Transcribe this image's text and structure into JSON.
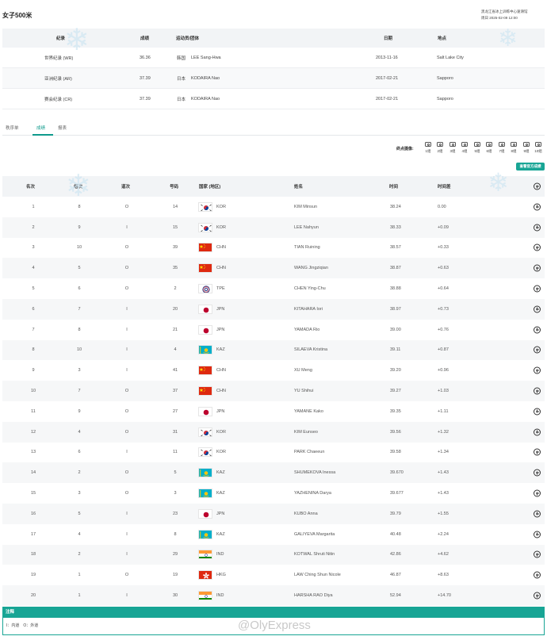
{
  "header": {
    "title": "女子500米",
    "venue_line1": "黑龙江省冰上训练中心速滑馆",
    "venue_line2": "周日 2025-02-09 12:00"
  },
  "records": {
    "headers": [
      "纪录",
      "成绩",
      "运动员/团体",
      "日期",
      "地点"
    ],
    "rows": [
      {
        "type": "世界纪录 (WR)",
        "time": "36.36",
        "country": "韩国",
        "athlete": "LEE Sang-Hwa",
        "date": "2013-11-16",
        "place": "Salt Lake City"
      },
      {
        "type": "亚洲纪录 (AR)",
        "time": "37.39",
        "country": "日本",
        "athlete": "KODAIRA Nao",
        "date": "2017-02-21",
        "place": "Sapporo"
      },
      {
        "type": "赛会纪录 (CR)",
        "time": "37.39",
        "country": "日本",
        "athlete": "KODAIRA Nao",
        "date": "2017-02-21",
        "place": "Sapporo"
      }
    ]
  },
  "tabs": [
    "秩序单",
    "成绩",
    "报表"
  ],
  "cameras": {
    "label": "终点摄像:",
    "groups": [
      "1组",
      "2组",
      "3组",
      "4组",
      "5组",
      "6组",
      "7组",
      "8组",
      "9组",
      "10组"
    ]
  },
  "official_button": "查看官方成绩",
  "results": {
    "headers": [
      "名次",
      "组次",
      "道次",
      "号码",
      "国家 (地区)",
      "姓名",
      "时间",
      "时间差"
    ],
    "rows": [
      {
        "rank": "1",
        "group": "8",
        "lane": "O",
        "bib": "14",
        "noc": "KOR",
        "name": "KIM Minsun",
        "time": "38.24",
        "diff": "0.00"
      },
      {
        "rank": "2",
        "group": "9",
        "lane": "I",
        "bib": "15",
        "noc": "KOR",
        "name": "LEE Nahyun",
        "time": "38.33",
        "diff": "+0.09"
      },
      {
        "rank": "3",
        "group": "10",
        "lane": "O",
        "bib": "39",
        "noc": "CHN",
        "name": "TIAN Ruining",
        "time": "38.57",
        "diff": "+0.33"
      },
      {
        "rank": "4",
        "group": "5",
        "lane": "O",
        "bib": "35",
        "noc": "CHN",
        "name": "WANG Jingziqian",
        "time": "38.87",
        "diff": "+0.63"
      },
      {
        "rank": "5",
        "group": "6",
        "lane": "O",
        "bib": "2",
        "noc": "TPE",
        "name": "CHEN Ying-Chu",
        "time": "38.88",
        "diff": "+0.64"
      },
      {
        "rank": "6",
        "group": "7",
        "lane": "I",
        "bib": "20",
        "noc": "JPN",
        "name": "KITAHARA Iori",
        "time": "38.97",
        "diff": "+0.73"
      },
      {
        "rank": "7",
        "group": "8",
        "lane": "I",
        "bib": "21",
        "noc": "JPN",
        "name": "YAMADA Rio",
        "time": "39.00",
        "diff": "+0.76"
      },
      {
        "rank": "8",
        "group": "10",
        "lane": "I",
        "bib": "4",
        "noc": "KAZ",
        "name": "SILAEVA Kristina",
        "time": "39.11",
        "diff": "+0.87"
      },
      {
        "rank": "9",
        "group": "3",
        "lane": "I",
        "bib": "41",
        "noc": "CHN",
        "name": "XU Meng",
        "time": "39.20",
        "diff": "+0.96"
      },
      {
        "rank": "10",
        "group": "7",
        "lane": "O",
        "bib": "37",
        "noc": "CHN",
        "name": "YU Shihui",
        "time": "39.27",
        "diff": "+1.03"
      },
      {
        "rank": "11",
        "group": "9",
        "lane": "O",
        "bib": "27",
        "noc": "JPN",
        "name": "YAMANE Kako",
        "time": "39.35",
        "diff": "+1.11"
      },
      {
        "rank": "12",
        "group": "4",
        "lane": "O",
        "bib": "31",
        "noc": "KOR",
        "name": "KIM Eunseo",
        "time": "39.56",
        "diff": "+1.32"
      },
      {
        "rank": "13",
        "group": "6",
        "lane": "I",
        "bib": "11",
        "noc": "KOR",
        "name": "PARK Chaeeun",
        "time": "39.58",
        "diff": "+1.34"
      },
      {
        "rank": "14",
        "group": "2",
        "lane": "O",
        "bib": "5",
        "noc": "KAZ",
        "name": "SHUMEKOVA Inessa",
        "time": "39.670",
        "diff": "+1.43"
      },
      {
        "rank": "15",
        "group": "3",
        "lane": "O",
        "bib": "3",
        "noc": "KAZ",
        "name": "YAZHENINA Darya",
        "time": "39.677",
        "diff": "+1.43"
      },
      {
        "rank": "16",
        "group": "5",
        "lane": "I",
        "bib": "23",
        "noc": "JPN",
        "name": "KUBO Anna",
        "time": "39.79",
        "diff": "+1.55"
      },
      {
        "rank": "17",
        "group": "4",
        "lane": "I",
        "bib": "8",
        "noc": "KAZ",
        "name": "GALIYEVA Margarita",
        "time": "40.48",
        "diff": "+2.24"
      },
      {
        "rank": "18",
        "group": "2",
        "lane": "I",
        "bib": "29",
        "noc": "IND",
        "name": "KOTWAL Shruti Nitin",
        "time": "42.86",
        "diff": "+4.62"
      },
      {
        "rank": "19",
        "group": "1",
        "lane": "O",
        "bib": "19",
        "noc": "HKG",
        "name": "LAW Ching Shun Nicole",
        "time": "46.87",
        "diff": "+8.63"
      },
      {
        "rank": "20",
        "group": "1",
        "lane": "I",
        "bib": "30",
        "noc": "IND",
        "name": "HARSHA RAO Diya",
        "time": "52.94",
        "diff": "+14.70"
      }
    ]
  },
  "notes": {
    "title": "注释",
    "text": "I：内道　O：外道"
  },
  "watermark": "@OlyExpress"
}
